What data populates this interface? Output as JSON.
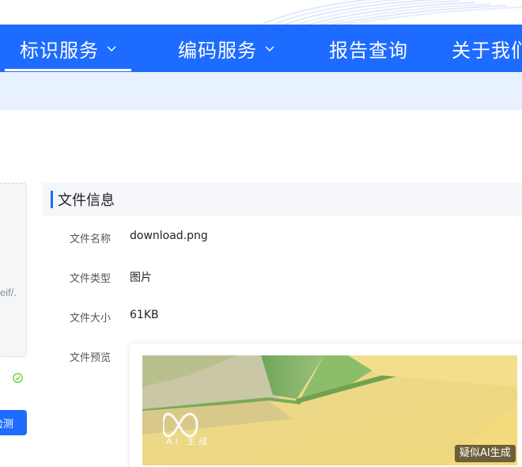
{
  "nav": {
    "items": [
      {
        "label": "标识服务",
        "has_dropdown": true,
        "active": true
      },
      {
        "label": "编码服务",
        "has_dropdown": true,
        "active": false
      },
      {
        "label": "报告查询",
        "has_dropdown": false,
        "active": false
      },
      {
        "label": "关于我们",
        "has_dropdown": false,
        "active": false
      }
    ]
  },
  "left_panel": {
    "text_fragment": "eif/.",
    "button_label": "检测"
  },
  "file_info": {
    "title": "文件信息",
    "name_label": "文件名称",
    "name_value": "download.png",
    "type_label": "文件类型",
    "type_value": "图片",
    "size_label": "文件大小",
    "size_value": "61KB",
    "preview_label": "文件预览",
    "watermark_text": "AI 生成",
    "ai_badge": "疑似AI生成"
  },
  "colors": {
    "primary": "#1e6bff",
    "sub_band": "#e8f1ff",
    "section_bg": "#f4f6f9"
  }
}
